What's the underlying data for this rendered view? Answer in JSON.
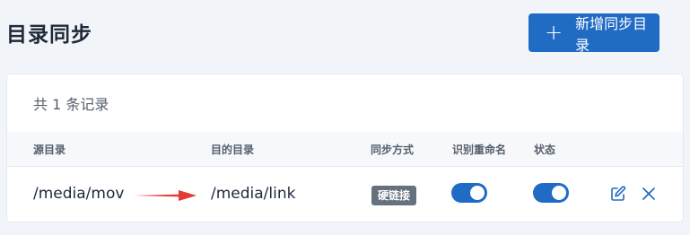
{
  "page": {
    "title": "目录同步"
  },
  "toolbar": {
    "add_label": "新增同步目录",
    "add_icon": "plus-icon"
  },
  "list": {
    "record_count": "共 1 条记录",
    "columns": [
      "源目录",
      "目的目录",
      "同步方式",
      "识别重命名",
      "状态"
    ],
    "rows": [
      {
        "source": "/media/mov",
        "target": "/media/link",
        "mode": "硬链接",
        "rename_enabled": true,
        "status_enabled": true
      }
    ]
  },
  "colors": {
    "accent": "#206bc4",
    "arrow": "#e53935",
    "badge": "#66717f"
  }
}
